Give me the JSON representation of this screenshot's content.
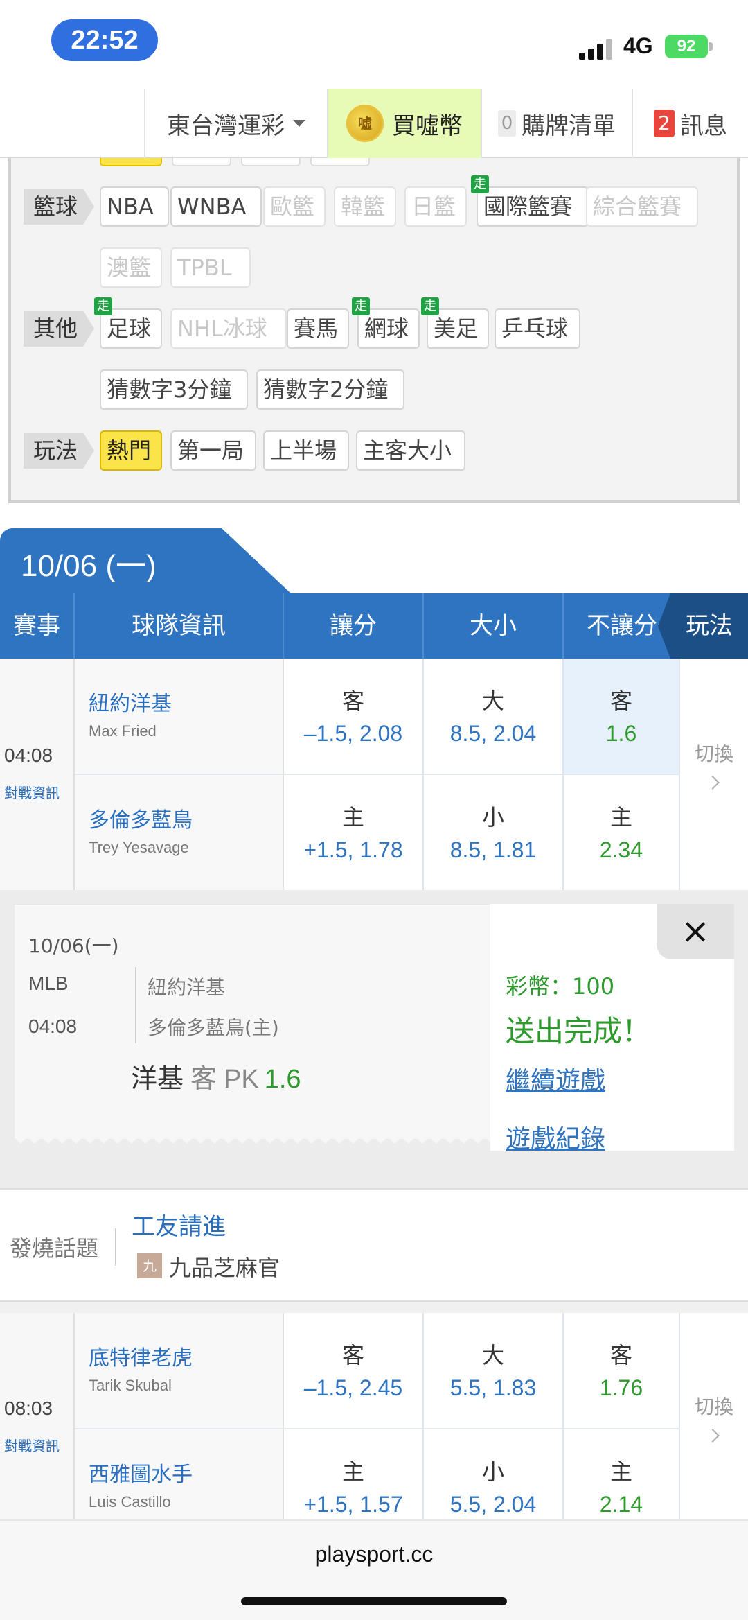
{
  "status": {
    "time": "22:52",
    "network": "4G",
    "battery": "92"
  },
  "nav": {
    "region": "東台灣運彩",
    "coin_icon_text": "噓",
    "coin": "買噓幣",
    "cart_count": "0",
    "cart": "購牌清單",
    "msg_count": "2",
    "msg": "訊息"
  },
  "filters": {
    "go_tag": "走",
    "basketball": {
      "label": "籃球",
      "items": [
        "NBA",
        "WNBA",
        "歐籃",
        "韓籃",
        "日籃",
        "國際籃賽",
        "綜合籃賽",
        "澳籃",
        "TPBL"
      ]
    },
    "other": {
      "label": "其他",
      "items": [
        "足球",
        "NHL冰球",
        "賽馬",
        "網球",
        "美足",
        "乒乓球",
        "猜數字3分鐘",
        "猜數字2分鐘"
      ]
    },
    "play": {
      "label": "玩法",
      "items": [
        "熱門",
        "第一局",
        "上半場",
        "主客大小"
      ]
    }
  },
  "date_tab": "10/06 (一)",
  "table_header": {
    "event": "賽事",
    "team": "球隊資訊",
    "spread": "讓分",
    "total": "大小",
    "moneyline": "不讓分",
    "play": "玩法"
  },
  "games": [
    {
      "time": "04:08",
      "h2h": "對戰資訊",
      "switch": "切換",
      "away": {
        "team": "紐約洋基",
        "pitcher": "Max Fried",
        "spread_side": "客",
        "spread": "–1.5, 2.08",
        "total_side": "大",
        "total": "8.5, 2.04",
        "ml_side": "客",
        "ml": "1.6"
      },
      "home": {
        "team": "多倫多藍鳥",
        "pitcher": "Trey Yesavage",
        "spread_side": "主",
        "spread": "+1.5, 1.78",
        "total_side": "小",
        "total": "8.5, 1.81",
        "ml_side": "主",
        "ml": "2.34"
      }
    },
    {
      "time": "08:03",
      "h2h": "對戰資訊",
      "switch": "切換",
      "away": {
        "team": "底特律老虎",
        "pitcher": "Tarik Skubal",
        "spread_side": "客",
        "spread": "–1.5, 2.45",
        "total_side": "大",
        "total": "5.5, 1.83",
        "ml_side": "客",
        "ml": "1.76"
      },
      "home": {
        "team": "西雅圖水手",
        "pitcher": "Luis Castillo",
        "spread_side": "主",
        "spread": "+1.5, 1.57",
        "total_side": "小",
        "total": "5.5, 2.04",
        "ml_side": "主",
        "ml": "2.14"
      }
    }
  ],
  "ticket": {
    "date": "10/06(一)",
    "league": "MLB",
    "time": "04:08",
    "team1": "紐約洋基",
    "team2": "多倫多藍鳥(主)",
    "bet_team": "洋基",
    "bet_side": "客",
    "bet_type": "PK",
    "bet_odd": "1.6"
  },
  "result": {
    "close": "×",
    "coin": "彩幣：100",
    "done": "送出完成！",
    "continue": "繼續遊戲",
    "history": "遊戲紀錄"
  },
  "hot": {
    "label": "發燒話題",
    "title": "工友請進",
    "avatar": "九",
    "author": "九品芝麻官"
  },
  "url": "playsport.cc"
}
